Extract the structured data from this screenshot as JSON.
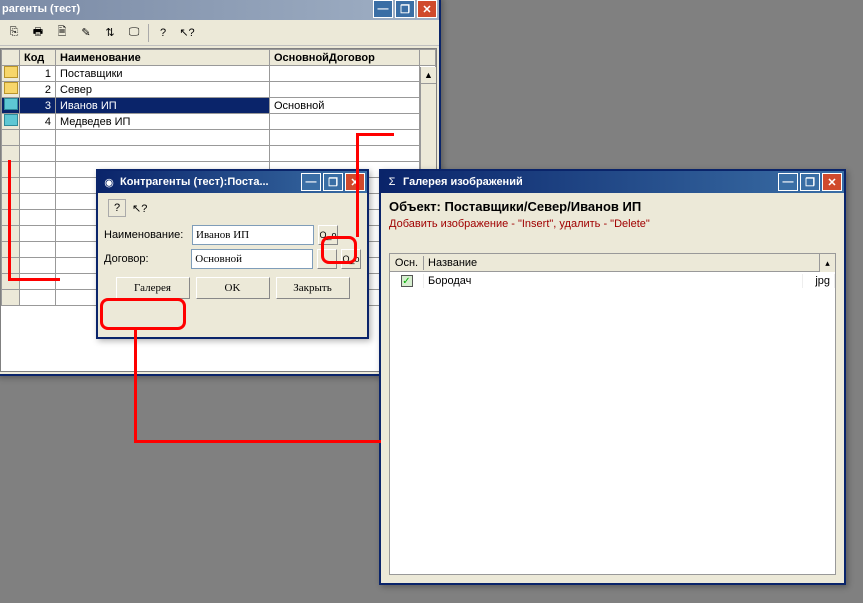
{
  "main_window": {
    "title": "рагенты (тест)",
    "columns": {
      "code": "Код",
      "name": "Наименование",
      "contract": "ОсновнойДоговор"
    },
    "rows": [
      {
        "icon": "folder",
        "code": "1",
        "name": "Поставщики",
        "contract": ""
      },
      {
        "icon": "folder",
        "code": "2",
        "name": "Север",
        "contract": ""
      },
      {
        "icon": "folder-blue",
        "code": "3",
        "name": "Иванов ИП",
        "contract": "Основной",
        "selected": true
      },
      {
        "icon": "folder-blue",
        "code": "4",
        "name": "Медведев ИП",
        "contract": ""
      }
    ]
  },
  "dialog": {
    "title": "Контрагенты (тест):Поста...",
    "labels": {
      "name": "Наименование:",
      "contract": "Договор:"
    },
    "values": {
      "name": "Иванов ИП",
      "contract": "Основной"
    },
    "oO": "О_о",
    "pick": "...",
    "buttons": {
      "gallery": "Галерея",
      "ok": "OK",
      "close": "Закрыть"
    }
  },
  "gallery": {
    "title": "Галерея изображений",
    "object_label": "Объект:",
    "object_path": "Поставщики/Север/Иванов ИП",
    "hint": "Добавить изображение - \"Insert\", удалить - \"Delete\"",
    "columns": {
      "main": "Осн.",
      "name": "Название"
    },
    "rows": [
      {
        "checked": true,
        "name": "Бородач",
        "ext": "jpg"
      }
    ],
    "ext_col": "jpg"
  },
  "window_icons": {
    "min": "—",
    "max": "❐",
    "close": "✕",
    "sigma": "Σ"
  }
}
